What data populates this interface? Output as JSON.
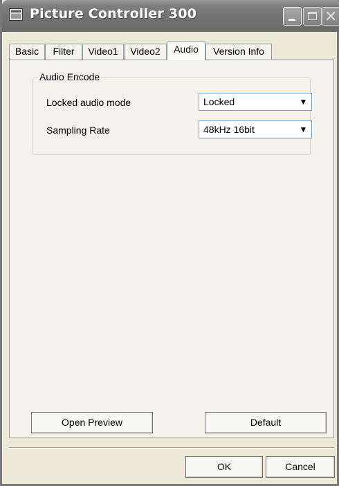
{
  "window": {
    "title": "Picture Controller 300"
  },
  "tabs": [
    {
      "label": "Basic"
    },
    {
      "label": "Filter"
    },
    {
      "label": "Video1"
    },
    {
      "label": "Video2"
    },
    {
      "label": "Audio"
    },
    {
      "label": "Version Info"
    }
  ],
  "active_tab": "Audio",
  "audio_encode": {
    "group_label": "Audio Encode",
    "locked_audio_mode": {
      "label": "Locked audio mode",
      "value": "Locked"
    },
    "sampling_rate": {
      "label": "Sampling Rate",
      "value": "48kHz 16bit"
    }
  },
  "buttons": {
    "open_preview": "Open Preview",
    "default": "Default",
    "ok": "OK",
    "cancel": "Cancel"
  },
  "icons": {
    "app": "app-window-icon",
    "minimize": "minimize-icon",
    "maximize": "maximize-icon",
    "close": "close-icon",
    "dropdown": "chevron-down-icon"
  }
}
